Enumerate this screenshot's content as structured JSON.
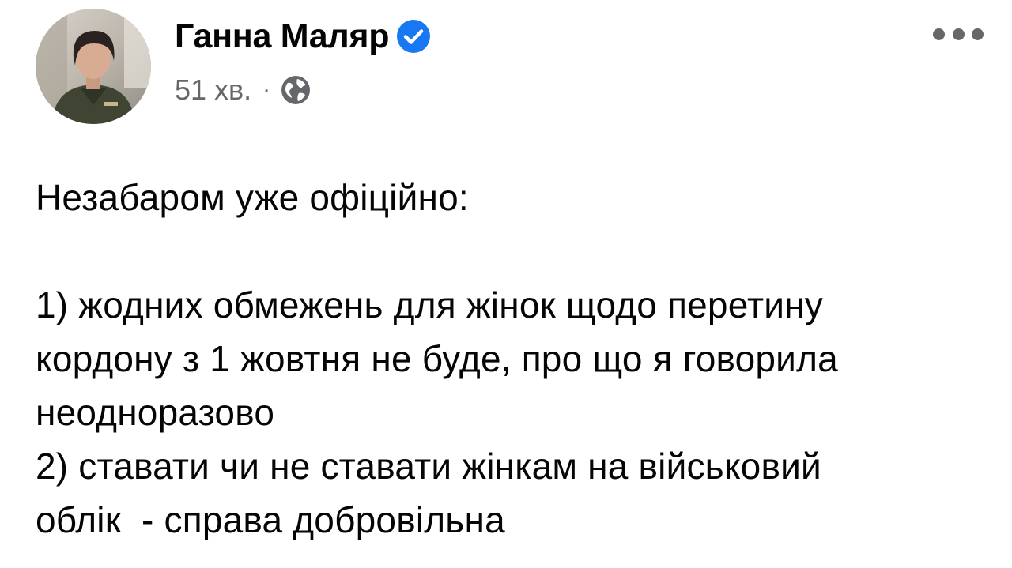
{
  "post": {
    "author": {
      "name": "Ганна Маляр",
      "verified": true,
      "verified_color": "#1877f2"
    },
    "meta": {
      "time": "51 хв.",
      "separator": "·",
      "audience_icon": "globe-icon"
    },
    "menu_icon": "more-dots-icon",
    "text": {
      "intro": "Незабаром уже офіційно:",
      "line1": "1) жодних обмежень для жінок щодо перетину",
      "line2": "кордону з 1 жовтня не буде, про що я говорила",
      "line3": "неодноразово",
      "line4": "2) ставати чи не ставати жінкам на військовий",
      "line5": "облік  - справа добровільна"
    }
  },
  "colors": {
    "text": "#050505",
    "secondary": "#65676b",
    "background": "#ffffff"
  }
}
